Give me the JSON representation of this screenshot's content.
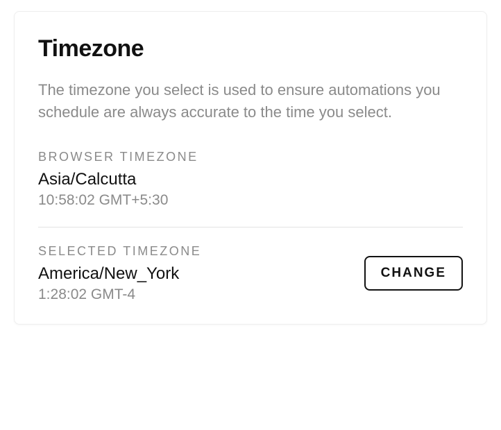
{
  "card": {
    "title": "Timezone",
    "description": "The timezone you select is used to ensure automations you schedule are always accurate to the time you select."
  },
  "browser_timezone": {
    "label": "BROWSER TIMEZONE",
    "value": "Asia/Calcutta",
    "time": "10:58:02 GMT+5:30"
  },
  "selected_timezone": {
    "label": "SELECTED TIMEZONE",
    "value": "America/New_York",
    "time": "1:28:02 GMT-4"
  },
  "actions": {
    "change_label": "CHANGE"
  }
}
